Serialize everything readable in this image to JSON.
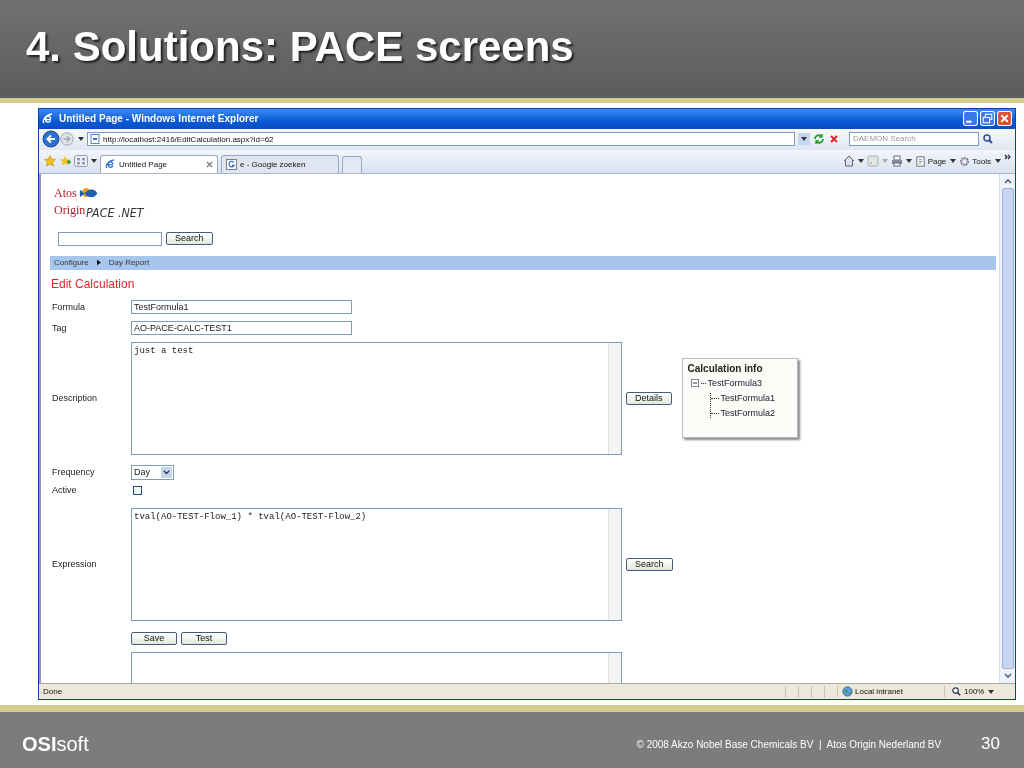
{
  "slide": {
    "title": "4. Solutions: PACE screens",
    "footer": {
      "logo": "**OSI**soft",
      "copyright": "© 2008 Akzo Nobel Base Chemicals BV  |  Atos Origin Nederland BV",
      "page_number": "30"
    }
  },
  "browser": {
    "title": "Untitled Page - Windows Internet Explorer",
    "address": "http://localhost:2416/EditCalculation.aspx?id=62",
    "search": {
      "placeholder": "DAEMON Search"
    },
    "tabs": [
      {
        "label": "Untitled Page",
        "selected": true
      },
      {
        "label": "e - Google zoeken",
        "selected": false
      }
    ],
    "toolbar": [
      {
        "label": "Page"
      },
      {
        "label": "Tools"
      }
    ],
    "status_bar": {
      "status": "Done",
      "zone": "Local intranet",
      "zoom": "100%"
    }
  },
  "page": {
    "logo": {
      "company_top": "Atos",
      "company_bottom": "Origin",
      "product": "PACE .NET"
    },
    "search_button": "Search",
    "breadcrumb": [
      "Configure",
      "Day Report"
    ],
    "heading": "Edit Calculation",
    "form": [
      {
        "kind": "text",
        "label": "Formula",
        "value": "TestFormula1"
      },
      {
        "kind": "text",
        "label": "Tag",
        "value": "AO-PACE-CALC-TEST1"
      },
      {
        "kind": "textarea",
        "label": "Description",
        "value": "just a test",
        "button": "Details",
        "info": {
          "title": "Calculation info",
          "tree": [
            {
              "label": "TestFormula3",
              "expanded": true,
              "children": [
                {
                  "label": "TestFormula1"
                },
                {
                  "label": "TestFormula2"
                }
              ]
            }
          ]
        }
      },
      {
        "kind": "select",
        "label": "Frequency",
        "value": "Day"
      },
      {
        "kind": "checkbox",
        "label": "Active",
        "checked": false
      },
      {
        "kind": "textarea",
        "label": "Expression",
        "value": "tval(AO-TEST-Flow_1) * tval(AO-TEST-Flow_2)",
        "button": "Search"
      }
    ],
    "actions": [
      "Save",
      "Test"
    ]
  }
}
